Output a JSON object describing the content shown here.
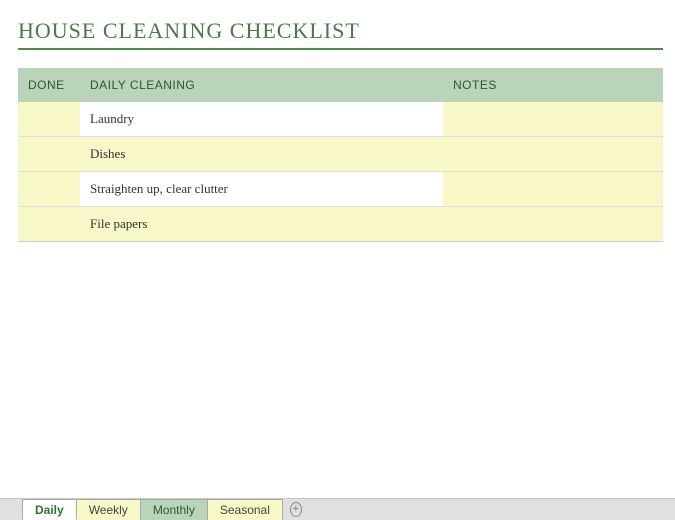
{
  "title": "HOUSE CLEANING CHECKLIST",
  "columns": {
    "done": "DONE",
    "task": "DAILY CLEANING",
    "notes": "NOTES"
  },
  "rows": [
    {
      "done": "",
      "task": "Laundry",
      "notes": ""
    },
    {
      "done": "",
      "task": "Dishes",
      "notes": ""
    },
    {
      "done": "",
      "task": "Straighten up, clear clutter",
      "notes": ""
    },
    {
      "done": "",
      "task": "File papers",
      "notes": ""
    }
  ],
  "tabs": {
    "daily": "Daily",
    "weekly": "Weekly",
    "monthly": "Monthly",
    "seasonal": "Seasonal"
  }
}
